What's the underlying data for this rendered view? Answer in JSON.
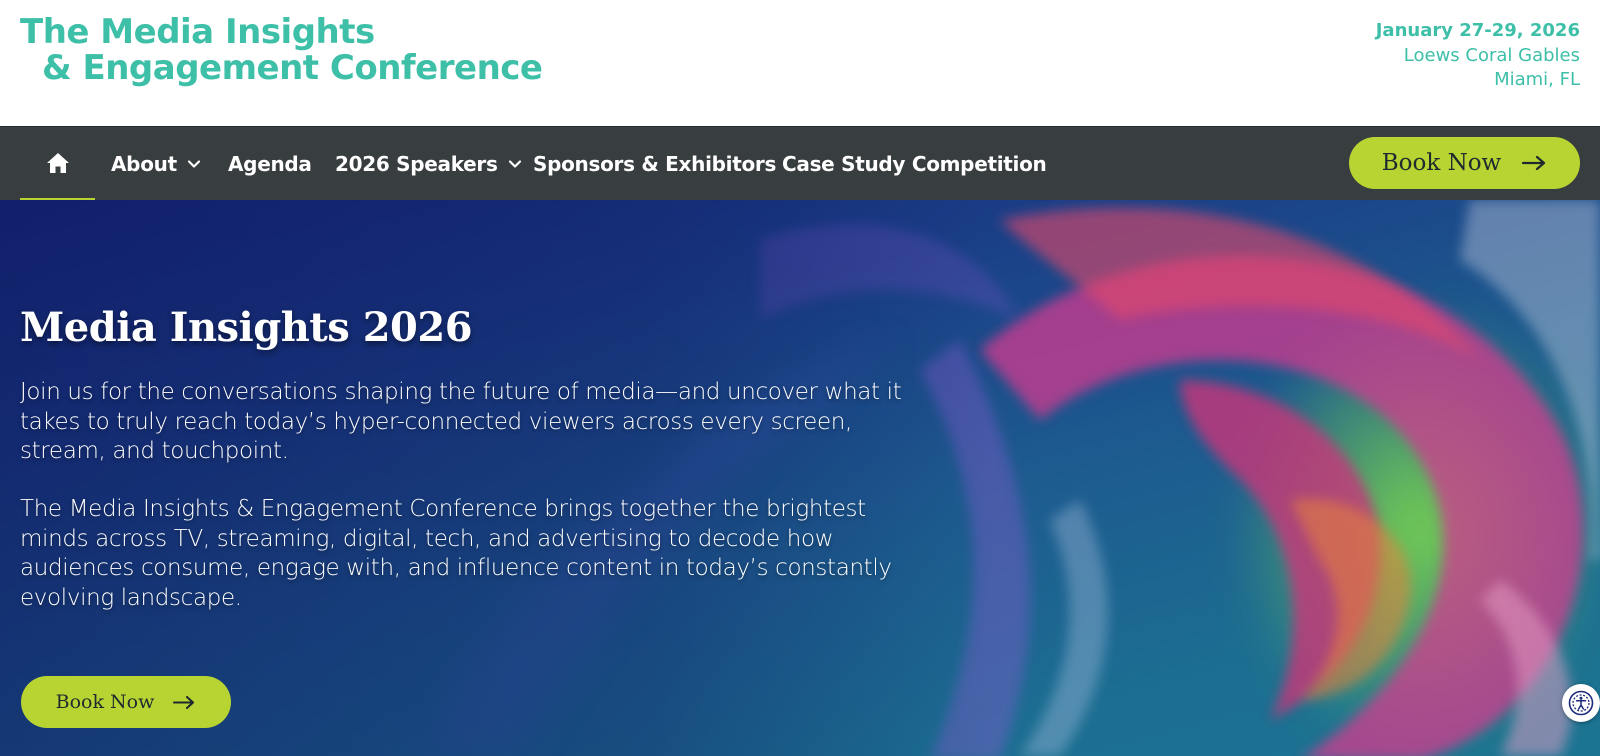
{
  "header": {
    "logo_line1": "The Media Insights",
    "logo_line2": "& Engagement Conference",
    "event_date": "January 27-29, 2026",
    "venue": "Loews Coral Gables",
    "city": "Miami, FL"
  },
  "nav": {
    "home_icon": "home-icon",
    "items": [
      {
        "label": "About",
        "has_dropdown": true
      },
      {
        "label": "Agenda",
        "has_dropdown": false
      },
      {
        "label": "2026 Speakers",
        "has_dropdown": true
      },
      {
        "label": "Sponsors & Exhibitors",
        "has_dropdown": false
      },
      {
        "label": "Case Study Competition",
        "has_dropdown": false
      }
    ],
    "book_label": "Book Now"
  },
  "hero": {
    "title": "Media Insights 2026",
    "paragraph1": "Join us for the conversations shaping the future of media—and uncover what it takes to truly reach today’s hyper-connected viewers across every screen, stream, and touchpoint.",
    "paragraph2": "The Media Insights & Engagement Conference brings together the brightest minds across TV, streaming, digital, tech, and advertising to decode how audiences consume, engage with, and influence content in today’s constantly evolving landscape.",
    "book_label": "Book Now"
  },
  "colors": {
    "brand_teal": "#3dbfa8",
    "accent_lime": "#b8d432",
    "nav_bg": "#383d3f",
    "hero_blue": "#16237a"
  },
  "icons": {
    "arrow": "arrow-right-icon",
    "chevron": "chevron-down-icon",
    "accessibility": "accessibility-icon"
  }
}
